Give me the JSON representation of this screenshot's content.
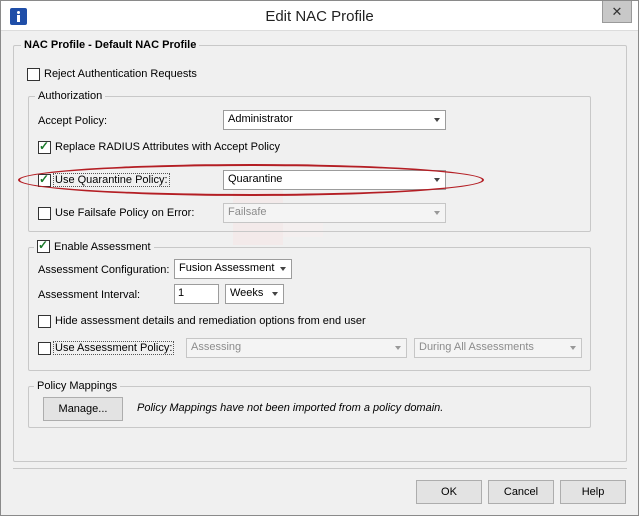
{
  "window": {
    "title": "Edit NAC Profile",
    "close_glyph": "✕"
  },
  "profile_group": {
    "legend": "NAC Profile - Default NAC Profile"
  },
  "reject": {
    "label": "Reject Authentication Requests",
    "checked": false
  },
  "authorization": {
    "legend": "Authorization",
    "accept_policy_label": "Accept Policy:",
    "accept_policy_value": "Administrator",
    "replace_radius_label": "Replace RADIUS Attributes with Accept Policy",
    "replace_radius_checked": true,
    "quarantine_label": "Use Quarantine Policy:",
    "quarantine_checked": true,
    "quarantine_value": "Quarantine",
    "failsafe_label": "Use Failsafe Policy on Error:",
    "failsafe_checked": false,
    "failsafe_value": "Failsafe"
  },
  "assessment": {
    "enable_label": "Enable Assessment",
    "enable_checked": true,
    "config_label": "Assessment Configuration:",
    "config_value": "Fusion Assessment",
    "interval_label": "Assessment Interval:",
    "interval_value": "1",
    "interval_unit": "Weeks",
    "hide_label": "Hide assessment details and remediation options from end user",
    "hide_checked": false,
    "use_policy_label": "Use Assessment Policy:",
    "use_policy_checked": false,
    "policy_value": "Assessing",
    "policy_when_value": "During All Assessments"
  },
  "mappings": {
    "legend": "Policy Mappings",
    "manage_label": "Manage...",
    "note": "Policy Mappings have not been imported from a policy domain."
  },
  "footer": {
    "ok_label": "OK",
    "cancel_label": "Cancel",
    "help_label": "Help"
  },
  "colors": {
    "highlight": "#b41e24",
    "check": "#1a7a2a",
    "app_icon": "#1f4ea8"
  }
}
